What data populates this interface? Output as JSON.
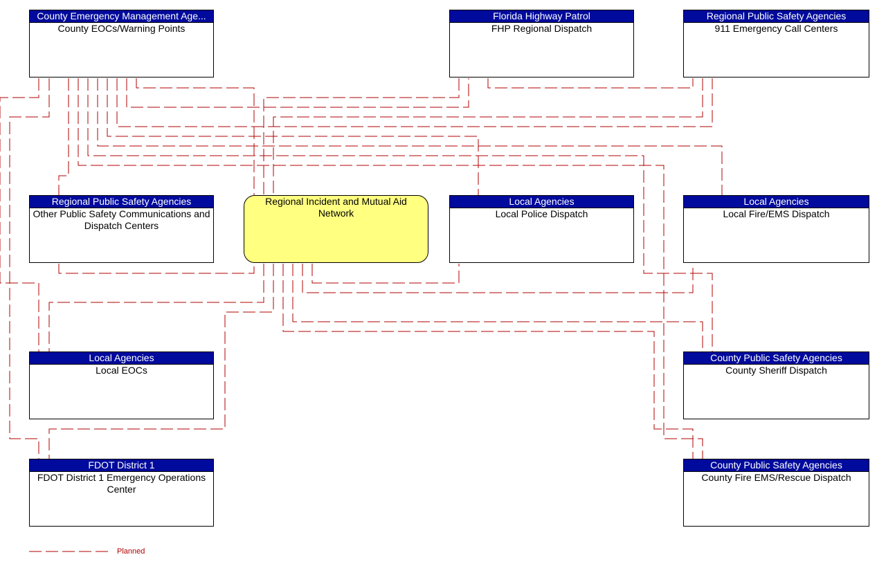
{
  "diagram": {
    "line_color": "#b00000",
    "header_color": "#000a9c",
    "center_fill": "#ffff80",
    "nodes": {
      "county_eoc": {
        "header": "County Emergency Management Age...",
        "name": "County EOCs/Warning Points"
      },
      "fhp": {
        "header": "Florida Highway Patrol",
        "name": "FHP Regional Dispatch"
      },
      "call_centers": {
        "header": "Regional Public Safety Agencies",
        "name": "911 Emergency Call Centers"
      },
      "other_ps": {
        "header": "Regional Public Safety Agencies",
        "name": "Other Public Safety Communications and Dispatch Centers"
      },
      "riman": {
        "name": "Regional Incident and Mutual Aid Network"
      },
      "local_police": {
        "header": "Local Agencies",
        "name": "Local Police Dispatch"
      },
      "local_fire": {
        "header": "Local Agencies",
        "name": "Local Fire/EMS Dispatch"
      },
      "local_eocs": {
        "header": "Local Agencies",
        "name": "Local EOCs"
      },
      "sheriff": {
        "header": "County Public Safety Agencies",
        "name": "County Sheriff Dispatch"
      },
      "fdot": {
        "header": "FDOT District 1",
        "name": "FDOT District 1 Emergency Operations Center"
      },
      "county_fire": {
        "header": "County Public Safety Agencies",
        "name": "County Fire EMS/Rescue Dispatch"
      }
    },
    "connections": [
      {
        "from": "county_eoc",
        "to": "riman",
        "status": "Planned"
      },
      {
        "from": "county_eoc",
        "to": "fhp",
        "status": "Planned"
      },
      {
        "from": "county_eoc",
        "to": "call_centers",
        "status": "Planned"
      },
      {
        "from": "county_eoc",
        "to": "other_ps",
        "status": "Planned"
      },
      {
        "from": "county_eoc",
        "to": "local_police",
        "status": "Planned"
      },
      {
        "from": "county_eoc",
        "to": "local_fire",
        "status": "Planned"
      },
      {
        "from": "county_eoc",
        "to": "local_eocs",
        "status": "Planned"
      },
      {
        "from": "county_eoc",
        "to": "sheriff",
        "status": "Planned"
      },
      {
        "from": "county_eoc",
        "to": "fdot",
        "status": "Planned"
      },
      {
        "from": "county_eoc",
        "to": "county_fire",
        "status": "Planned"
      },
      {
        "from": "fhp",
        "to": "riman",
        "status": "Planned"
      },
      {
        "from": "fhp",
        "to": "call_centers",
        "status": "Planned"
      },
      {
        "from": "call_centers",
        "to": "riman",
        "status": "Planned"
      },
      {
        "from": "other_ps",
        "to": "riman",
        "status": "Planned"
      },
      {
        "from": "riman",
        "to": "local_police",
        "status": "Planned"
      },
      {
        "from": "riman",
        "to": "local_fire",
        "status": "Planned"
      },
      {
        "from": "riman",
        "to": "local_eocs",
        "status": "Planned"
      },
      {
        "from": "riman",
        "to": "fdot",
        "status": "Planned"
      },
      {
        "from": "riman",
        "to": "sheriff",
        "status": "Planned"
      },
      {
        "from": "riman",
        "to": "county_fire",
        "status": "Planned"
      }
    ]
  },
  "legend": {
    "planned_label": "Planned"
  }
}
